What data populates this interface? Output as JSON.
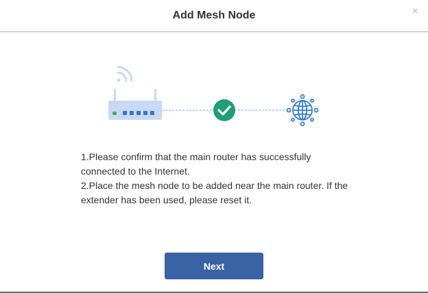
{
  "dialog": {
    "title": "Add Mesh Node",
    "close_glyph": "×"
  },
  "illustration": {
    "icons": [
      "router-icon",
      "wifi-signal-icon",
      "check-icon",
      "globe-icon"
    ],
    "colors": {
      "router": "#c8d9f3",
      "router_port": "#3e6fd1",
      "router_led": "#38b24a",
      "check_circle": "#1f9e78",
      "globe": "#2f7bd8",
      "dashed_line": "#7fa4d6"
    }
  },
  "instructions": {
    "line1": "1.Please confirm that the main router has successfully connected to the Internet.",
    "line2": "2.Place the mesh node to be added near the main router. If the extender has been used, please reset it."
  },
  "footer": {
    "next_label": "Next"
  }
}
